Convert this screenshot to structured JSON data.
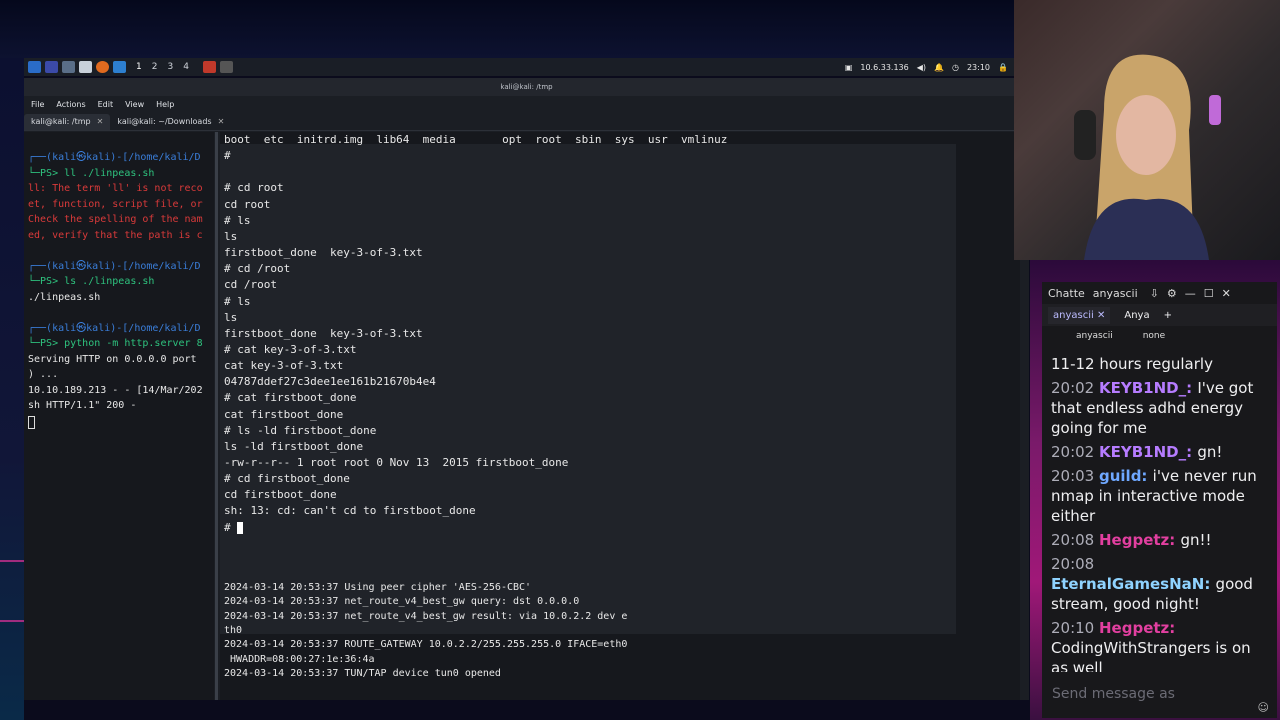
{
  "taskbar": {
    "workspaces": [
      "1",
      "2",
      "3",
      "4"
    ],
    "ip": "10.6.33.136",
    "clock": "23:10"
  },
  "terminal": {
    "window_title": "kali@kali: /tmp",
    "menu": [
      "File",
      "Actions",
      "Edit",
      "View",
      "Help"
    ],
    "tabs": [
      {
        "label": "kali@kali: /tmp",
        "active": true
      },
      {
        "label": "kali@kali: ~/Downloads",
        "active": false
      }
    ],
    "left_pane": [
      {
        "text": "┌──(kali㉿kali)-[/home/kali/D",
        "color": "blue"
      },
      {
        "text": "└─PS> ll ./linpeas.sh",
        "color": "mixed"
      },
      {
        "text": "ll: The term 'll' is not reco",
        "color": "red"
      },
      {
        "text": "et, function, script file, or",
        "color": "red"
      },
      {
        "text": "Check the spelling of the nam",
        "color": "red"
      },
      {
        "text": "ed, verify that the path is c",
        "color": "red"
      },
      {
        "text": "",
        "color": "white"
      },
      {
        "text": "┌──(kali㉿kali)-[/home/kali/D",
        "color": "blue"
      },
      {
        "text": "└─PS> ls ./linpeas.sh",
        "color": "mixed"
      },
      {
        "text": "./linpeas.sh",
        "color": "white"
      },
      {
        "text": "",
        "color": "white"
      },
      {
        "text": "┌──(kali㉿kali)-[/home/kali/D",
        "color": "blue"
      },
      {
        "text": "└─PS> python -m http.server 8",
        "color": "mixed"
      },
      {
        "text": "Serving HTTP on 0.0.0.0 port",
        "color": "white"
      },
      {
        "text": ") ...",
        "color": "white"
      },
      {
        "text": "10.10.189.213 - - [14/Mar/202",
        "color": "white"
      },
      {
        "text": "sh HTTP/1.1\" 200 -",
        "color": "white"
      }
    ],
    "right_pane_lines": [
      "boot  etc  initrd.img  lib64  media       opt  root  sbin  sys  usr  vmlinuz",
      "#",
      "",
      "# cd root",
      "cd root",
      "# ls",
      "ls",
      "firstboot_done  key-3-of-3.txt",
      "# cd /root",
      "cd /root",
      "# ls",
      "ls",
      "firstboot_done  key-3-of-3.txt",
      "# cat key-3-of-3.txt",
      "cat key-3-of-3.txt",
      "04787ddef27c3dee1ee161b21670b4e4",
      "# cat firstboot_done",
      "cat firstboot_done",
      "# ls -ld firstboot_done",
      "ls -ld firstboot_done",
      "-rw-r--r-- 1 root root 0 Nov 13  2015 firstboot_done",
      "# cd firstboot_done",
      "cd firstboot_done",
      "sh: 13: cd: can't cd to firstboot_done",
      "# "
    ],
    "log_lines": [
      "2024-03-14 20:53:37 Using peer cipher 'AES-256-CBC'",
      "2024-03-14 20:53:37 net_route_v4_best_gw query: dst 0.0.0.0",
      "2024-03-14 20:53:37 net_route_v4_best_gw result: via 10.0.2.2 dev e",
      "th0",
      "2024-03-14 20:53:37 ROUTE_GATEWAY 10.0.2.2/255.255.255.0 IFACE=eth0",
      " HWADDR=08:00:27:1e:36:4a",
      "2024-03-14 20:53:37 TUN/TAP device tun0 opened"
    ]
  },
  "chat": {
    "title": "Chatte",
    "channel": "anyascii",
    "tabs": [
      "anyascii",
      "Anya"
    ],
    "sub_user": "anyascii",
    "sub_mode": "none",
    "messages": [
      {
        "time": "",
        "user": "",
        "text": "11-12 hours regularly",
        "color": "#ffffff"
      },
      {
        "time": "20:02",
        "user": "KEYB1ND_:",
        "text": "I've got that endless adhd energy going for me",
        "color": "#b67cff"
      },
      {
        "time": "20:02",
        "user": "KEYB1ND_:",
        "text": "gn!",
        "color": "#b67cff"
      },
      {
        "time": "20:03",
        "user": "guild:",
        "text": "i've never run nmap in interactive mode either",
        "color": "#6fa8ff"
      },
      {
        "time": "20:08",
        "user": "Hegpetz:",
        "text": "gn!!",
        "color": "#e23fa0"
      },
      {
        "time": "20:08",
        "user": "EternalGamesNaN:",
        "text": "good stream, good night!",
        "color": "#8fd3ff"
      },
      {
        "time": "20:10",
        "user": "Hegpetz:",
        "text": "CodingWithStrangers is on as well",
        "color": "#e23fa0"
      }
    ],
    "input_placeholder": "Send message as"
  }
}
